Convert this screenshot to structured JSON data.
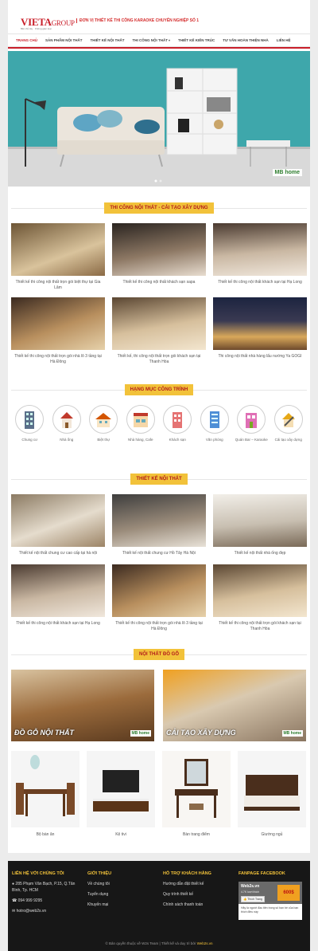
{
  "header": {
    "logo_main": "VIETA",
    "logo_group": "GROUP",
    "logo_tag": "Bền thủ tây · Không gian loại",
    "tagline": "ĐƠN VỊ THIẾT KẾ THI CÔNG KARAOKE CHUYÊN NGHIỆP SỐ 1"
  },
  "nav": [
    {
      "label": "Trang chủ",
      "has_submenu": false
    },
    {
      "label": "Sản phẩm nội thất",
      "has_submenu": false
    },
    {
      "label": "Thiết kế nội thất",
      "has_submenu": false
    },
    {
      "label": "Thi công nội thất",
      "has_submenu": true
    },
    {
      "label": "Thiết kế kiến trúc",
      "has_submenu": false
    },
    {
      "label": "Tư vấn hoàn thiện nhà",
      "has_submenu": false
    },
    {
      "label": "Liên hệ",
      "has_submenu": false
    }
  ],
  "hero": {
    "badge": "MB home"
  },
  "section1": {
    "title": "THI CÔNG NỘI THẤT - CẢI TẠO XÂY DỰNG",
    "items": [
      "Thiết kế thi công nội thất trọn gói biệt thự tại Gia Lâm",
      "Thiết kế thi công nội thất khách sạn sapa",
      "Thiết kế thi công nội thất khách sạn tại Hạ Long",
      "Thiết kế thi công nội thất trọn gói nhà lô 3 tầng tại Hà Đông",
      "Thiết kế, thi công nội thất trọn gói khách sạn tại Thanh Hóa",
      "Thi công nội thất nhà hàng lẩu nướng Ya GOGI"
    ]
  },
  "section2": {
    "title": "HẠNG MỤC CÔNG TRÌNH",
    "items": [
      {
        "label": "Chung cư",
        "icon": "apartment-icon"
      },
      {
        "label": "Nhà ống",
        "icon": "townhouse-icon"
      },
      {
        "label": "Biệt thự",
        "icon": "villa-icon"
      },
      {
        "label": "Nhà hàng, Cafe",
        "icon": "restaurant-icon"
      },
      {
        "label": "Khách sạn",
        "icon": "hotel-icon"
      },
      {
        "label": "Văn phòng",
        "icon": "office-icon"
      },
      {
        "label": "Quán Bar – Karaoke",
        "icon": "bar-icon"
      },
      {
        "label": "Cải tạo xây dựng",
        "icon": "renovation-icon"
      }
    ]
  },
  "section3": {
    "title": "THIẾT KẾ NỘI THẤT",
    "items": [
      "Thiết kế nội thất chung cư cao cấp tại hà nội",
      "Thiết kế nội thất chung cư Hồ Tây Hà Nội",
      "Thiết kế nội thất nhà ống đẹp",
      "Thiết kế thi công nội thất khách sạn tại Hạ Long",
      "Thiết kế thi công nội thất trọn gói nhà lô 3 tầng tại Hà Đông",
      "Thiết kế thi công nội thất trọn gói khách sạn tại Thanh Hóa"
    ]
  },
  "section4": {
    "title": "NỘI THẤT ĐỒ GỖ",
    "banners": [
      {
        "text": "ĐỒ GỖ NỘI THẤT",
        "badge": "MB home"
      },
      {
        "text": "CẢI TẠO XÂY DỰNG",
        "badge": "MB home"
      }
    ],
    "products": [
      "Bộ bàn ăn",
      "Kệ tivi",
      "Bàn trang điểm",
      "Giường ngủ"
    ]
  },
  "footer": {
    "contact": {
      "title": "LIÊN HỆ VỚI CHÚNG TÔI",
      "address": "285 Phạm Văn Bạch, P.15, Q.Tân Bình, Tp. HCM",
      "phone": "094 999 9295",
      "email": "hotro@web2s.vn"
    },
    "intro": {
      "title": "GIỚI THIỆU",
      "links": [
        "Về chúng tôi",
        "Tuyển dụng",
        "Khuyến mại"
      ]
    },
    "support": {
      "title": "HỖ TRỢ KHÁCH HÀNG",
      "links": [
        "Hướng dẫn đặt thiết kế",
        "Quy trình thiết kế",
        "Chính sách thanh toán"
      ]
    },
    "fanpage": {
      "title": "FANPAGE FACEBOOK",
      "page_name": "Web2s.vn",
      "likes": "4.7K lượt thích",
      "like_button": "Thích Trang",
      "promo": "600$",
      "note": "Hãy là người đầu tiên trong số bạn bè của bạn thích điều này"
    },
    "copyright_pre": "© Bản quyền thuộc về W2s Team | Thiết kế và duy trì bởi ",
    "copyright_brand": "Web2s.vn"
  }
}
